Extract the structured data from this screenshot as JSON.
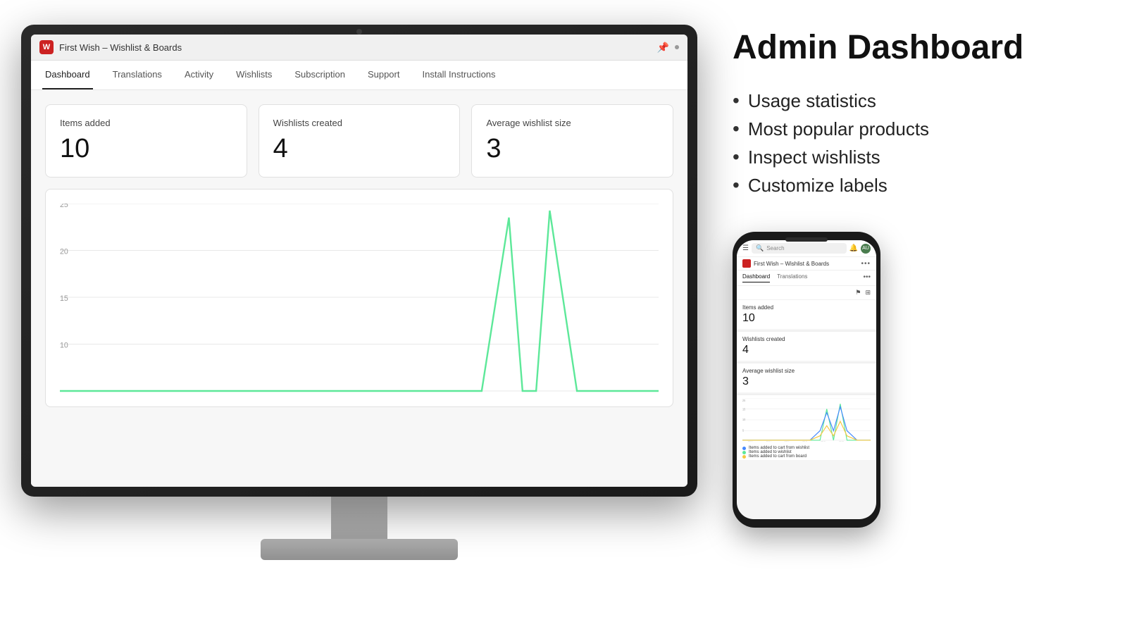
{
  "monitor": {
    "title": "First Wish – Wishlist & Boards",
    "pin_icon": "📌",
    "camera": true
  },
  "nav": {
    "tabs": [
      {
        "label": "Dashboard",
        "active": true
      },
      {
        "label": "Translations",
        "active": false
      },
      {
        "label": "Activity",
        "active": false
      },
      {
        "label": "Wishlists",
        "active": false
      },
      {
        "label": "Subscription",
        "active": false
      },
      {
        "label": "Support",
        "active": false
      },
      {
        "label": "Install Instructions",
        "active": false
      }
    ]
  },
  "stats": {
    "items_added_label": "Items added",
    "items_added_value": "10",
    "wishlists_created_label": "Wishlists created",
    "wishlists_created_value": "4",
    "avg_wishlist_label": "Average wishlist size",
    "avg_wishlist_value": "3"
  },
  "chart": {
    "y_labels": [
      "25",
      "20",
      "15",
      "10"
    ],
    "color": "#5de899"
  },
  "right": {
    "title": "Admin Dashboard",
    "features": [
      "Usage statistics",
      "Most popular products",
      "Inspect wishlists",
      "Customize labels"
    ]
  },
  "phone": {
    "search_placeholder": "Search",
    "avatar_text": "AU",
    "app_title": "First Wish – Wishlist & Boards",
    "tabs": [
      "Dashboard",
      "Translations"
    ],
    "items_added_label": "Items added",
    "items_added_value": "10",
    "wishlists_created_label": "Wishlists created",
    "wishlists_created_value": "4",
    "avg_wishlist_label": "Average wishlist size",
    "avg_wishlist_value": "3",
    "legend": [
      {
        "color": "#4488ff",
        "label": "Items added to cart from wishlist"
      },
      {
        "color": "#5de899",
        "label": "Items added to wishlist"
      },
      {
        "color": "#f5c842",
        "label": "Items added to cart from board"
      }
    ]
  }
}
